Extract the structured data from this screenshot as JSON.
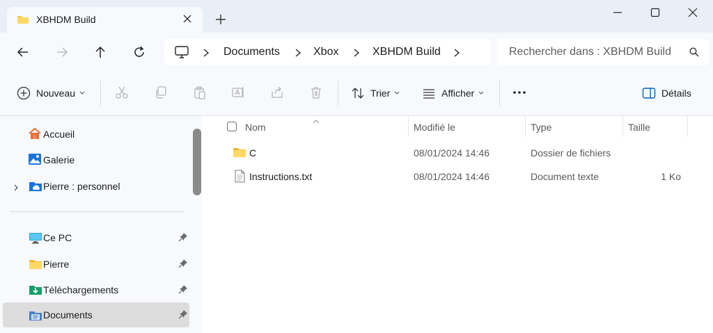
{
  "window": {
    "tab_title": "XBHDM Build"
  },
  "nav": {
    "breadcrumbs": [
      {
        "label": "Documents"
      },
      {
        "label": "Xbox"
      },
      {
        "label": "XBHDM Build"
      }
    ],
    "search_placeholder": "Rechercher dans : XBHDM Build"
  },
  "toolbar": {
    "new_label": "Nouveau",
    "sort_label": "Trier",
    "view_label": "Afficher",
    "details_label": "Détails"
  },
  "sidebar": {
    "items": [
      {
        "label": "Accueil",
        "icon": "home-icon"
      },
      {
        "label": "Galerie",
        "icon": "gallery-icon"
      },
      {
        "label": "Pierre : personnel",
        "icon": "onedrive-folder-icon"
      },
      {
        "label": "Ce PC",
        "icon": "pc-icon"
      },
      {
        "label": "Pierre",
        "icon": "folder-icon"
      },
      {
        "label": "Téléchargements",
        "icon": "downloads-icon"
      },
      {
        "label": "Documents",
        "icon": "documents-icon"
      }
    ]
  },
  "files": {
    "columns": [
      "Nom",
      "Modifié le",
      "Type",
      "Taille"
    ],
    "rows": [
      {
        "name": "C",
        "modified": "08/01/2024 14:46",
        "type": "Dossier de fichiers",
        "size": "",
        "icon": "folder-icon"
      },
      {
        "name": "Instructions.txt",
        "modified": "08/01/2024 14:46",
        "type": "Document texte",
        "size": "1 Ko",
        "icon": "text-file-icon"
      }
    ]
  },
  "colors": {
    "accent": "#005fb8",
    "folder": "#f7c948",
    "chrome_bg": "#e9eff7",
    "panel_bg": "#f7f9fc"
  }
}
